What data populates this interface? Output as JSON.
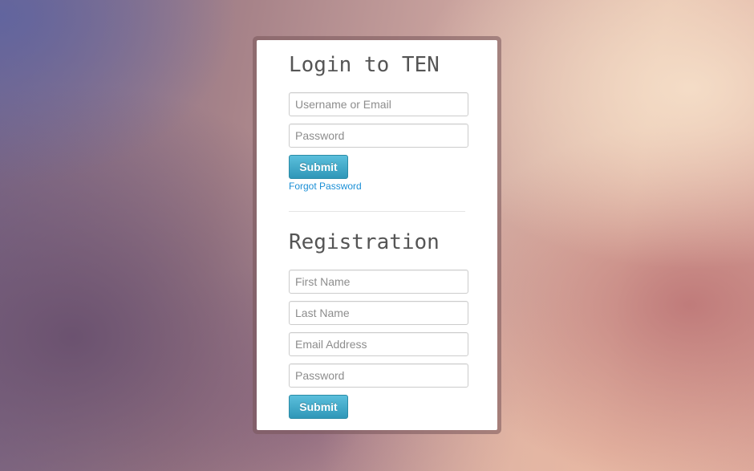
{
  "login": {
    "title": "Login to TEN",
    "username_placeholder": "Username or Email",
    "password_placeholder": "Password",
    "submit_label": "Submit",
    "forgot_label": "Forgot Password"
  },
  "registration": {
    "title": "Registration",
    "first_name_placeholder": "First Name",
    "last_name_placeholder": "Last Name",
    "email_placeholder": "Email Address",
    "password_placeholder": "Password",
    "submit_label": "Submit"
  },
  "colors": {
    "button_top": "#5bbfdc",
    "button_bottom": "#2f97b8",
    "link": "#1a8fd6",
    "heading": "#555555"
  }
}
